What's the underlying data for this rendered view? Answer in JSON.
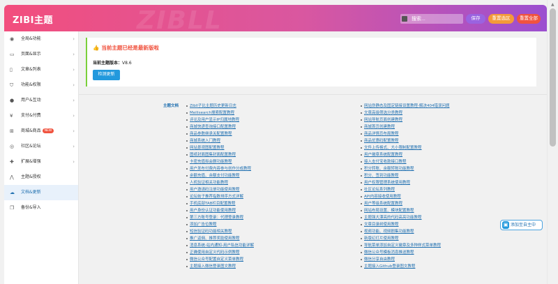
{
  "header": {
    "logo": "ZIBI主题",
    "watermark": "ZIBLL",
    "search_placeholder": "搜索...",
    "save_label": "保存",
    "reset_option_label": "重置选区",
    "reset_all_label": "重置全部"
  },
  "sidebar": {
    "items": [
      {
        "label": "全局&功能",
        "icon": "globe-icon"
      },
      {
        "label": "页面&显示",
        "icon": "monitor-icon"
      },
      {
        "label": "文章&列表",
        "icon": "book-icon"
      },
      {
        "label": "功能&权限",
        "icon": "shield-icon"
      },
      {
        "label": "用户&互动",
        "icon": "user-icon"
      },
      {
        "label": "支付&付费",
        "icon": "yen-icon"
      },
      {
        "label": "商城&商品",
        "icon": "cart-icon",
        "badge": "NEW"
      },
      {
        "label": "社区&论坛",
        "icon": "compass-icon"
      },
      {
        "label": "扩展&增强",
        "icon": "puzzle-icon"
      },
      {
        "label": "主题&授权",
        "icon": "chart-icon"
      },
      {
        "label": "文档&更新",
        "icon": "cloud-icon",
        "active": true
      },
      {
        "label": "备份&导入",
        "icon": "copy-icon"
      }
    ]
  },
  "notice": {
    "title": "当前主题已经是最新版啦",
    "version_label": "当前主题版本：",
    "version_value": "V8.6",
    "check_button": "检测更新"
  },
  "docs": {
    "label": "主题文档",
    "left": [
      "Zibll子比主题历史更新日志",
      "Meilisearch搜索配置教程",
      "评论及用户显示IP归属地教程",
      "商城快递查询接口配置教程",
      "商品参数继承关配置教程",
      "商城系统入门教程",
      "网站景观图配置教程",
      "图纸封面图集封面配置教程",
      "卡密充值拟会删功能教程",
      "用户发布付费内容参与创作分成教程",
      "余额充值、余额支付功能教程",
      "人机验证相关功能教程",
      "用户邀请码注册功能使用教程",
      "论坛帖子推荐指数排序方式详解",
      "手机底部TAB栏目配置教程",
      "用户身份认证功能使用教程",
      "第三方账号登录：代理登录教程",
      "添加广告位教程",
      "短信验证码功能相关教程",
      "推广返佣、推荐奖励使用教程",
      "消息系统-站内通知-用户私信功能详解",
      "正确使用自定义代码示例教程",
      "微信公众号配置自定义菜单教程",
      "主题接入微信登录图文教程"
    ],
    "right": [
      "网站伪静态及固定链接设置教程-解决404错误问题",
      "文章高级筛选分类教程",
      "网站导航页面创建教程",
      "商城首页创建教程",
      "商品详情页布局教程",
      "商品优惠码配置教程",
      "文件上传格式、大小限制配置教程",
      "用户徽章系统配置教程",
      "接入支付宝收款接口教程",
      "积分转账、余额转账功能教程",
      "积分、签到功能教程",
      "用户权限管理系统使用教程",
      "社区论坛系列教程",
      "API内容接收使用教程",
      "用户等级系统配置教程",
      "网站布局设置、模块配置教程",
      "主题强大漂亮的代码高亮功能教程",
      "文章目录树使用教程",
      "视频功能、视频剧集功能教程",
      "新版幻灯片使用教程",
      "导航菜单添加自定义徽章及多种样式菜单教程",
      "微信公众号模板消息推送教程",
      "微信分享自由教程",
      "主题接入Github登录图文教程"
    ]
  },
  "float_button": "添加至自主中"
}
